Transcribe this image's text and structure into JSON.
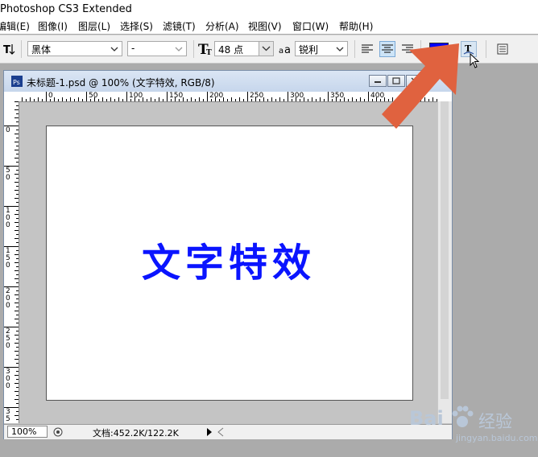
{
  "app": {
    "title": "Photoshop CS3 Extended"
  },
  "menu": [
    "编辑(E)",
    "图像(I)",
    "图层(L)",
    "选择(S)",
    "滤镜(T)",
    "分析(A)",
    "视图(V)",
    "窗口(W)",
    "帮助(H)"
  ],
  "options": {
    "font_family": "黑体",
    "font_style": "-",
    "font_size": "48 点",
    "aa_icon": "a",
    "antialias": "锐利",
    "text_color": "#0000ff",
    "icons": [
      "text-orientation-icon",
      "font-size-icon",
      "antialias-icon",
      "align-left-icon",
      "align-center-icon",
      "align-right-icon",
      "warp-text-icon",
      "character-panel-icon"
    ]
  },
  "document": {
    "title": "未标题-1.psd @ 100% (文字特效, RGB/8)",
    "canvas_text": "文字特效",
    "canvas_text_color": "#0a14ff",
    "ruler_h_labels": [
      "0",
      "50",
      "100",
      "150",
      "200",
      "250",
      "300",
      "350",
      "400"
    ],
    "ruler_v_labels": [
      "0",
      "5\n0",
      "1\n0\n0",
      "1\n5\n0",
      "2\n0\n0",
      "2\n5\n0",
      "3\n0\n0",
      "3\n5"
    ],
    "zoom": "100%",
    "doc_info": "文档:452.2K/122.2K"
  },
  "watermark": {
    "brand": "Bai",
    "suffix": "经验",
    "url": "jingyan.baidu.com"
  },
  "annotation": {
    "arrow_color": "#e0623f"
  }
}
